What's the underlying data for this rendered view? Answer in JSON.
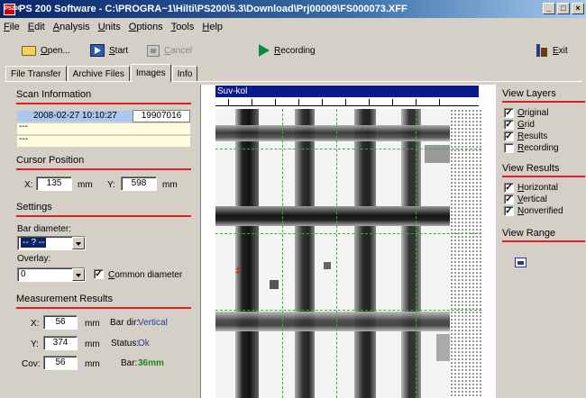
{
  "window": {
    "title": "PS 200 Software - C:\\PROGRA~1\\Hilti\\PS200\\5.3\\Download\\Prj00009\\FS000073.XFF",
    "app_icon_text": "PS200",
    "controls": [
      "_",
      "□",
      "×"
    ]
  },
  "menu": [
    "File",
    "Edit",
    "Analysis",
    "Units",
    "Options",
    "Tools",
    "Help"
  ],
  "toolbar": {
    "open": "Open...",
    "start": "Start",
    "cancel": "Cancel",
    "recording": "Recording",
    "exit": "Exit"
  },
  "tabs": [
    "File Transfer",
    "Archive Files",
    "Images",
    "Info"
  ],
  "active_tab": "Images",
  "scan_info": {
    "heading": "Scan Information",
    "date": "2008-02-27 10:10:27",
    "id": "19907016",
    "row2": "---",
    "row3": "---"
  },
  "cursor_position": {
    "heading": "Cursor Position",
    "x_label": "X:",
    "x_value": "135",
    "x_unit": "mm",
    "y_label": "Y:",
    "y_value": "598",
    "y_unit": "mm"
  },
  "settings": {
    "heading": "Settings",
    "bar_diameter_label": "Bar diameter:",
    "bar_diameter_value": "-- ? --",
    "overlay_label": "Overlay:",
    "overlay_value": "0",
    "common_diameter_label": "Common diameter",
    "common_diameter_checked": true
  },
  "measurement": {
    "heading": "Measurement Results",
    "x_label": "X:",
    "x_value": "56",
    "x_unit": "mm",
    "y_label": "Y:",
    "y_value": "374",
    "y_unit": "mm",
    "cov_label": "Cov:",
    "cov_value": "56",
    "cov_unit": "mm",
    "bar_dir_label": "Bar dir:",
    "bar_dir_value": "Vertical",
    "status_label": "Status:",
    "status_value": "Ok",
    "bar_label": "Bar:",
    "bar_value": "36mm"
  },
  "image_view": {
    "header": "Suv-kol",
    "marker": "‡"
  },
  "view_layers": {
    "heading": "View Layers",
    "items": [
      {
        "label": "Original",
        "checked": true
      },
      {
        "label": "Grid",
        "checked": true
      },
      {
        "label": "Results",
        "checked": true
      },
      {
        "label": "Recording",
        "checked": false
      }
    ]
  },
  "view_results": {
    "heading": "View Results",
    "items": [
      {
        "label": "Horizontal",
        "checked": true
      },
      {
        "label": "Vertical",
        "checked": true
      },
      {
        "label": "Nonverified",
        "checked": true
      }
    ]
  },
  "view_range": {
    "heading": "View Range"
  },
  "colors": {
    "accent_red": "#e02020",
    "title_blue": "#0a246a",
    "value_blue": "#2a3aa0",
    "bar_green": "#1a8a1a",
    "grid_green": "#3ab03a"
  }
}
